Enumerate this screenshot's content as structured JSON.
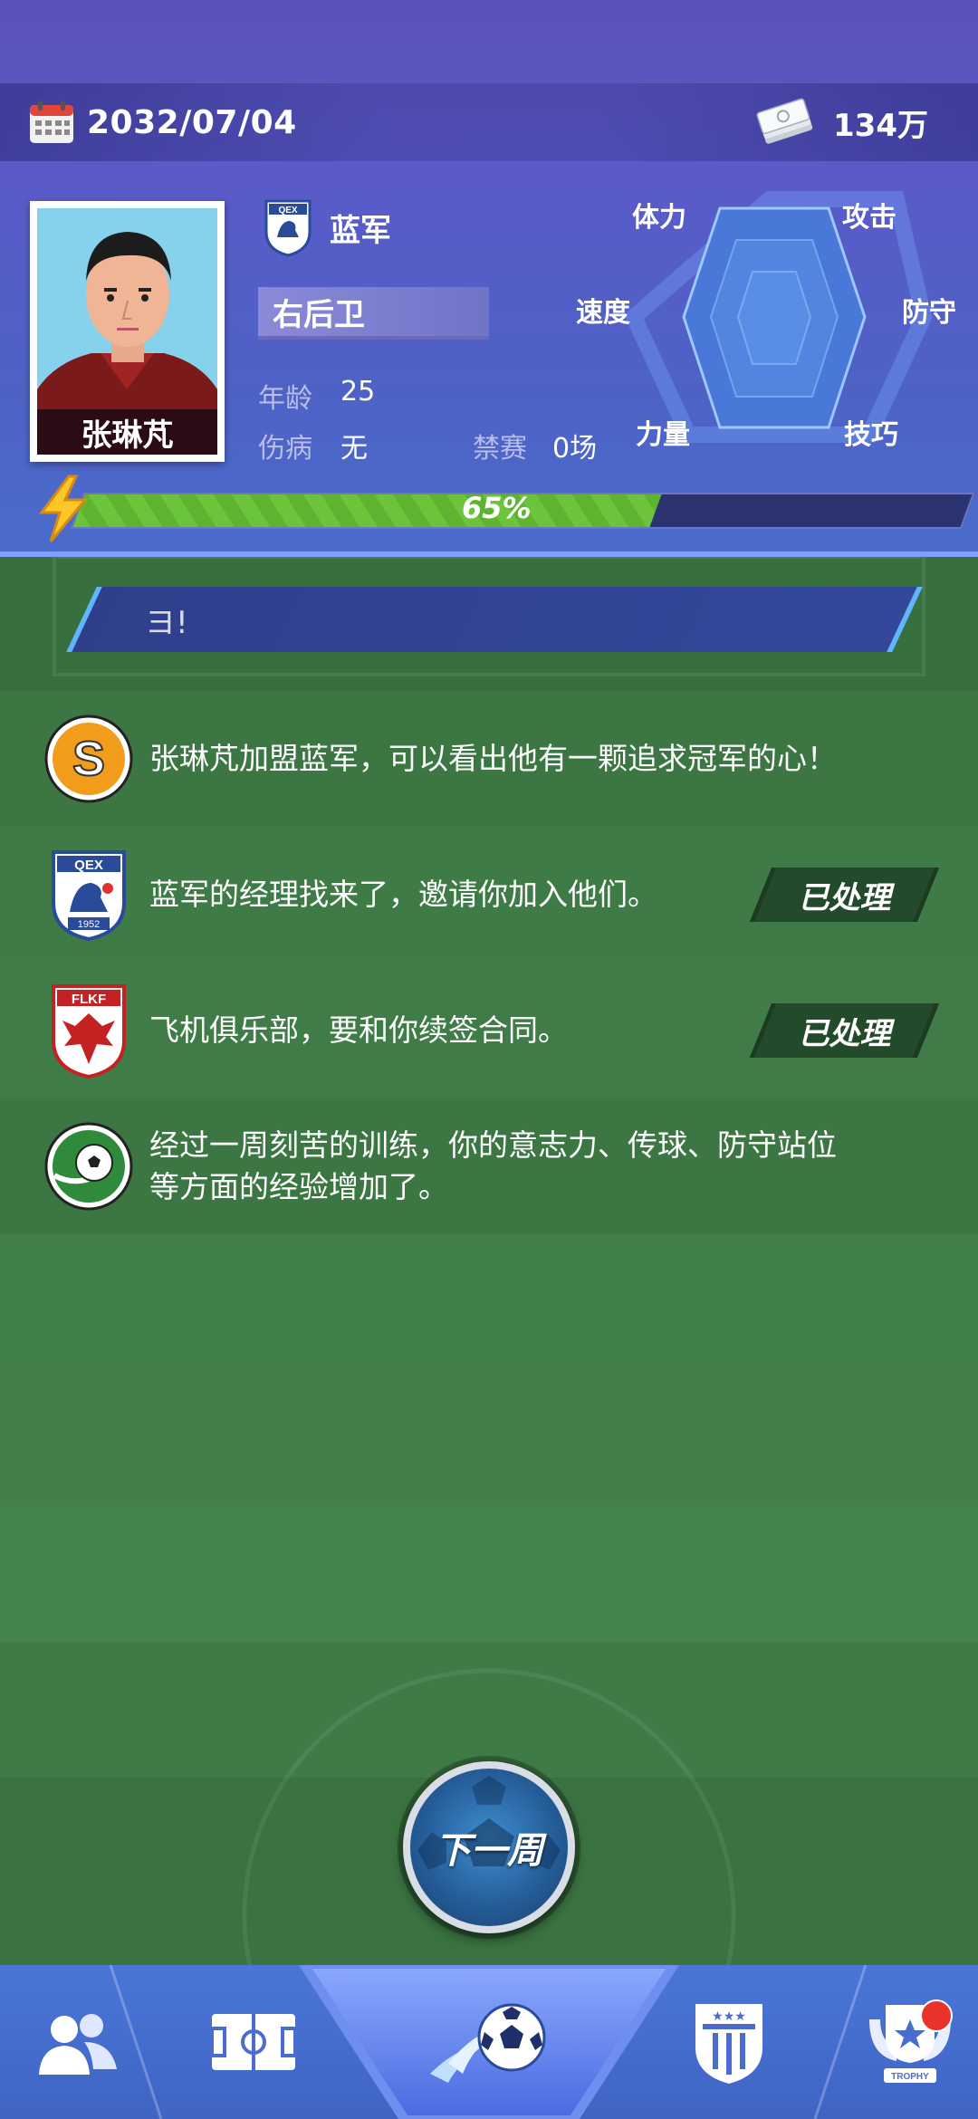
{
  "header": {
    "date": "2032/07/04",
    "money": "134万",
    "player_name": "张琳芃",
    "team_name": "蓝军",
    "position": "右后卫",
    "age_label": "年龄",
    "age_value": "25",
    "injury_label": "伤病",
    "injury_value": "无",
    "ban_label": "禁赛",
    "ban_value": "0场",
    "energy_percent": 65,
    "energy_text": "65%"
  },
  "radar": {
    "labels": {
      "stamina": "体力",
      "attack": "攻击",
      "speed": "速度",
      "defense": "防守",
      "strength": "力量",
      "skill": "技巧"
    }
  },
  "ticker": {
    "text": "ヨ!"
  },
  "messages": [
    {
      "icon": "sponsor-s-icon",
      "text": "张琳芃加盟蓝军，可以看出他有一颗追求冠军的心！",
      "button": ""
    },
    {
      "icon": "qex-club-crest-icon",
      "text": "蓝军的经理找来了，邀请你加入他们。",
      "button": "已处理"
    },
    {
      "icon": "flkf-club-crest-icon",
      "text": "飞机俱乐部，要和你续签合同。",
      "button": "已处理"
    },
    {
      "icon": "training-ball-icon",
      "text": "经过一周刻苦的训练，你的意志力、传球、防守站位等方面的经验增加了。",
      "button": ""
    }
  ],
  "crests": {
    "qex_text": "QEX",
    "qex_year": "1952",
    "flkf_text": "FLKF"
  },
  "next_week": "下一周",
  "nav": {
    "items": [
      "players-icon",
      "pitch-icon",
      "match-ball-icon",
      "league-shield-icon",
      "trophy-icon"
    ],
    "trophy_text": "TROPHY"
  },
  "colors": {
    "header": "#5a5ac8",
    "feed_green": "#3f7a45",
    "energy_green": "#6cc43a",
    "nav_blue": "#4a76d8",
    "alert_red": "#e8322a"
  }
}
